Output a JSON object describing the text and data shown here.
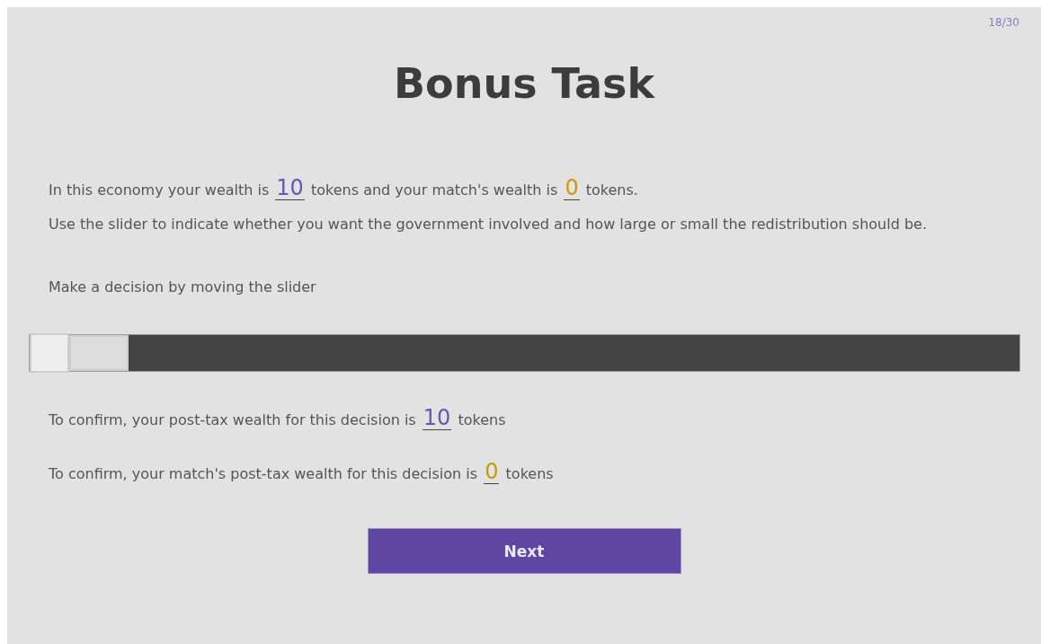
{
  "progress": "18/30",
  "title": "Bonus Task",
  "paragraphs": [
    {
      "segments": [
        {
          "kind": "text",
          "text": "In this economy your wealth is"
        },
        {
          "kind": "value",
          "text": "10",
          "color": "#6a55b0"
        },
        {
          "kind": "text",
          "text": "tokens and your match's wealth is"
        },
        {
          "kind": "value",
          "text": "0",
          "color": "#c99a10"
        },
        {
          "kind": "text",
          "text": "tokens."
        }
      ]
    },
    {
      "segments": [
        {
          "kind": "text",
          "text": "Use the slider to indicate whether you want the government involved and how large or small the redistribution should be."
        }
      ]
    }
  ],
  "slider": {
    "label": "Make a decision by moving the slider",
    "level": 0.06
  },
  "confirmations": [
    {
      "segments": [
        {
          "kind": "text",
          "text": "To confirm, your post-tax wealth for this decision is"
        },
        {
          "kind": "value",
          "text": "10",
          "color": "#6a55b0"
        },
        {
          "kind": "text",
          "text": "tokens"
        }
      ]
    },
    {
      "segments": [
        {
          "kind": "text",
          "text": "To confirm, your match's post-tax wealth for this decision is"
        },
        {
          "kind": "value",
          "text": "0",
          "color": "#c99a10"
        },
        {
          "kind": "text",
          "text": "tokens"
        }
      ]
    }
  ],
  "button": "Next"
}
